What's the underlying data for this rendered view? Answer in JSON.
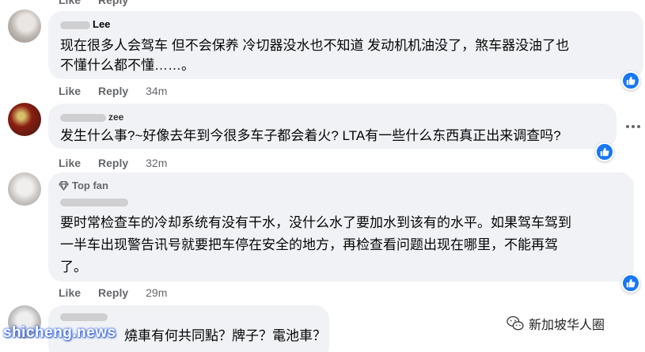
{
  "comments": [
    {
      "author": "Lee",
      "text_lines": [
        "现在很多人会驾车 但不会保养 冷切器没水也不知道 发动机机油没了，煞车器没油了也",
        "不懂什么都不懂……。"
      ],
      "like_label": "Like",
      "reply_label": "Reply",
      "time": "34m"
    },
    {
      "author": "",
      "text_lines": [
        "发生什么事?~好像去年到今很多车子都会着火? LTA有一些什么东西真正出来调查吗?"
      ],
      "like_label": "Like",
      "reply_label": "Reply",
      "time": "32m"
    },
    {
      "badge": "Top fan",
      "author": "",
      "text_lines": [
        "要时常检查车的冷却系统有没有干水，没什么水了要加水到该有的水平。如果驾车驾到",
        "一半车出现警告讯号就要把车停在安全的地方，再检查看问题出现在哪里，不能再驾",
        "了。"
      ],
      "like_label": "Like",
      "reply_label": "Reply",
      "time": "29m"
    },
    {
      "author": "",
      "text_lines": [
        "燒車有何共同點？牌子？電池車？"
      ]
    }
  ],
  "top_partial": {
    "like_label": "Like",
    "reply_label": "Reply"
  },
  "watermark": "shicheng.news",
  "brand_name": "新加坡华人圈",
  "colors": {
    "bubble": "#f0f2f5",
    "action_text": "#65676b",
    "like_blue": "#1877f2"
  },
  "icons": [
    "thumbs-up-icon",
    "more-options-icon",
    "top-fan-diamond-icon",
    "wechat-icon"
  ]
}
